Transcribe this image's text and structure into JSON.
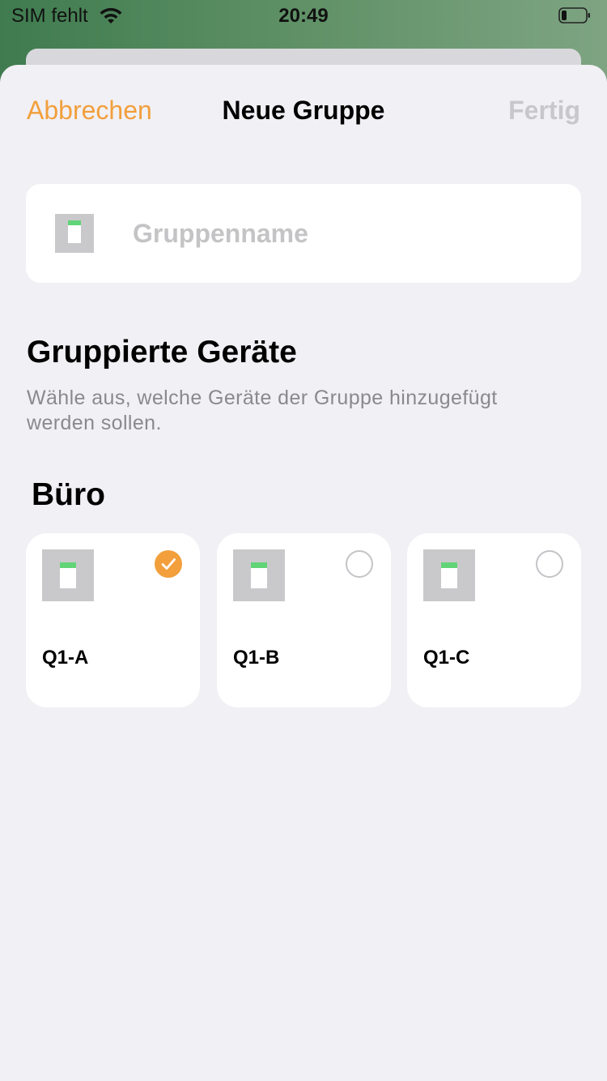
{
  "status_bar": {
    "carrier": "SIM fehlt",
    "time": "20:49",
    "wifi_icon": "wifi-icon",
    "battery_icon": "battery-low-icon"
  },
  "nav": {
    "cancel_label": "Abbrechen",
    "title": "Neue Gruppe",
    "done_label": "Fertig"
  },
  "group_name": {
    "icon": "device-icon",
    "placeholder": "Gruppenname",
    "value": ""
  },
  "grouped_devices": {
    "title": "Gruppierte Geräte",
    "description": "Wähle aus, welche Geräte der Gruppe hinzugefügt werden sollen."
  },
  "room": {
    "name": "Büro",
    "devices": [
      {
        "label": "Q1-A",
        "selected": true,
        "icon": "device-icon"
      },
      {
        "label": "Q1-B",
        "selected": false,
        "icon": "device-icon"
      },
      {
        "label": "Q1-C",
        "selected": false,
        "icon": "device-icon"
      }
    ]
  },
  "colors": {
    "accent": "#f29f3c",
    "disabled": "#c8c7cc",
    "background": "#f1f0f5",
    "led": "#62d478"
  }
}
